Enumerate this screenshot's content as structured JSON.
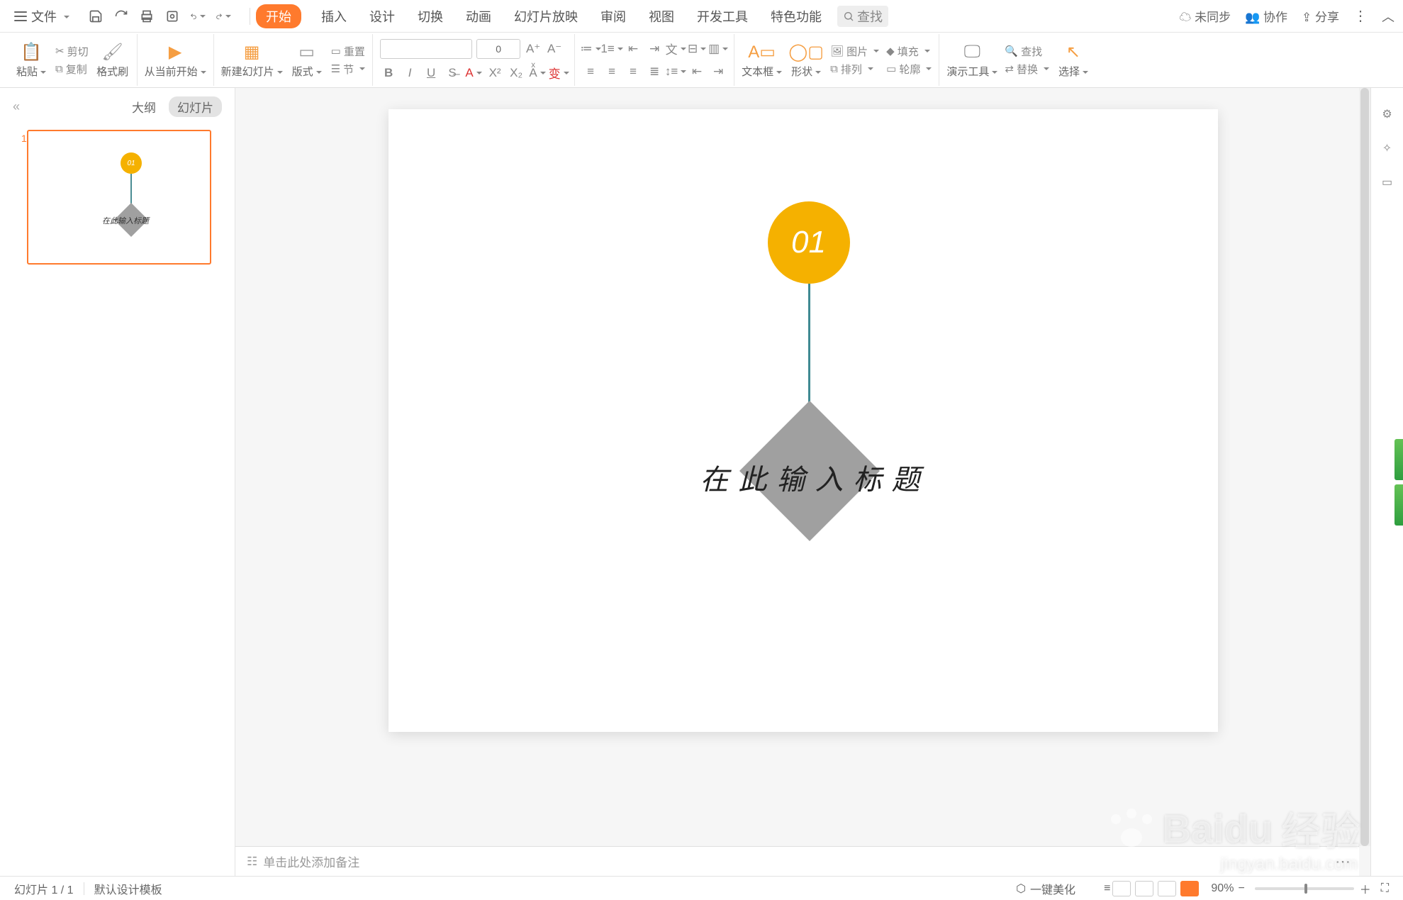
{
  "menu": {
    "file": "文件",
    "tabs": [
      "开始",
      "插入",
      "设计",
      "切换",
      "动画",
      "幻灯片放映",
      "审阅",
      "视图",
      "开发工具",
      "特色功能"
    ],
    "active_tab_index": 0,
    "search_placeholder": "查找",
    "sync": "未同步",
    "collab": "协作",
    "share": "分享"
  },
  "ribbon": {
    "paste": "粘贴",
    "cut": "剪切",
    "copy": "复制",
    "format_painter": "格式刷",
    "start_from_current": "从当前开始",
    "new_slide": "新建幻灯片",
    "layout": "版式",
    "section": "节",
    "reset": "重置",
    "font_size_value": "0",
    "textbox": "文本框",
    "shape": "形状",
    "picture": "图片",
    "arrange": "排列",
    "fill": "填充",
    "outline": "轮廓",
    "presenter_tools": "演示工具",
    "find": "查找",
    "replace": "替换",
    "select": "选择"
  },
  "side": {
    "outline_tab": "大纲",
    "slides_tab": "幻灯片",
    "thumb_number": "1",
    "thumb_circle": "01",
    "thumb_title": "在此输入标题"
  },
  "slide": {
    "circle_text": "01",
    "title_text": "在此输入标题"
  },
  "notes_placeholder": "单击此处添加备注",
  "status": {
    "slide_counter": "幻灯片 1 / 1",
    "template": "默认设计模板",
    "beautify": "一键美化",
    "zoom_value": "90%"
  },
  "watermark": {
    "brand": "Baidu",
    "label": "经验",
    "sub": "jingyan.baidu.com"
  }
}
